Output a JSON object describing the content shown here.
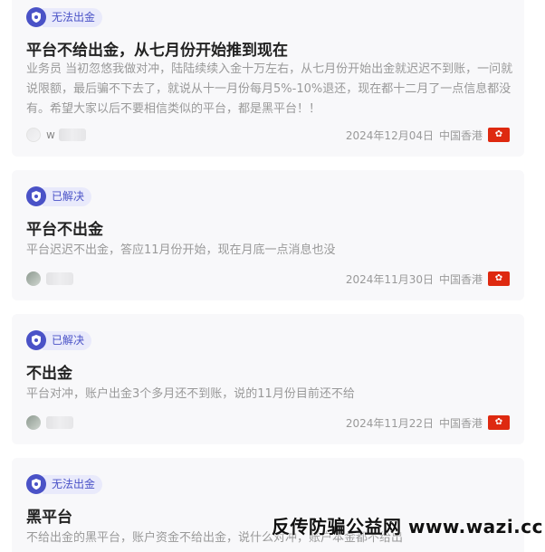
{
  "posts": [
    {
      "status": "无法出金",
      "title": "平台不给出金，从七月份开始推到现在",
      "desc": "业务员 当初忽悠我做对冲，陆陆续续入金十万左右，从七月份开始出金就迟迟不到账，一问就说限额，最后骗不下去了，就说从十一月份每月5%-10%退还，现在都十二月了一点信息都没有。希望大家以后不要相信类似的平台，都是黑平台！！",
      "user": "w",
      "date": "2024年12月04日",
      "region": "中国香港"
    },
    {
      "status": "已解决",
      "title": "平台不出金",
      "desc": "平台迟迟不出金，答应11月份开始，现在月底一点消息也没",
      "user": "",
      "date": "2024年11月30日",
      "region": "中国香港"
    },
    {
      "status": "已解决",
      "title": "不出金",
      "desc": "平台对冲，账户出金3个多月还不到账，说的11月份目前还不给",
      "user": "",
      "date": "2024年11月22日",
      "region": "中国香港"
    },
    {
      "status": "无法出金",
      "title": "黑平台",
      "desc": "不给出金的黑平台，账户资金不给出金，说什么对冲，账户本金都不给出",
      "user": "",
      "date": "",
      "region": ""
    }
  ],
  "watermark": "反传防骗公益网 www.wazi.cc",
  "icons": {
    "status": "shield-icon",
    "flag": "hong-kong-flag-icon"
  },
  "colors": {
    "accent": "#4a52c7",
    "badge_bg": "#e9eafb",
    "flag": "#de2910"
  }
}
